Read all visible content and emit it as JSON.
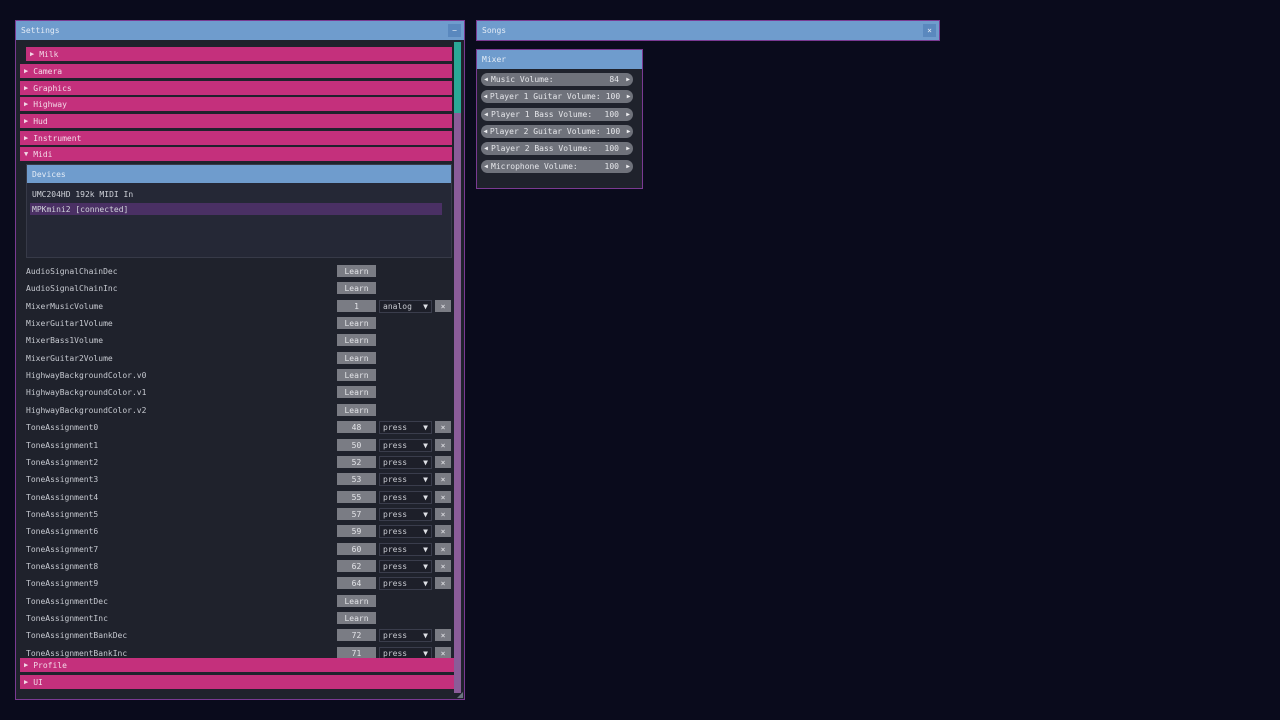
{
  "settings_window": {
    "title": "Settings",
    "collapse_glyph": "−",
    "sections_top": [
      {
        "label": "Milk",
        "arrow": "▶"
      },
      {
        "label": "Camera",
        "arrow": "▶"
      },
      {
        "label": "Graphics",
        "arrow": "▶"
      },
      {
        "label": "Highway",
        "arrow": "▶"
      },
      {
        "label": "Hud",
        "arrow": "▶"
      },
      {
        "label": "Instrument",
        "arrow": "▶"
      },
      {
        "label": "Midi",
        "arrow": "▼"
      }
    ],
    "devices": {
      "title": "Devices",
      "items": [
        "UMC204HD 192k MIDI In",
        "MPKmini2 [connected]"
      ]
    },
    "midi_rows": [
      {
        "label": "AudioSignalChainDec",
        "button": "Learn"
      },
      {
        "label": "AudioSignalChainInc",
        "button": "Learn"
      },
      {
        "label": "MixerMusicVolume",
        "button": "1",
        "mode": "analog",
        "clear": "×"
      },
      {
        "label": "MixerGuitar1Volume",
        "button": "Learn"
      },
      {
        "label": "MixerBass1Volume",
        "button": "Learn"
      },
      {
        "label": "MixerGuitar2Volume",
        "button": "Learn"
      },
      {
        "label": "HighwayBackgroundColor.v0",
        "button": "Learn"
      },
      {
        "label": "HighwayBackgroundColor.v1",
        "button": "Learn"
      },
      {
        "label": "HighwayBackgroundColor.v2",
        "button": "Learn"
      },
      {
        "label": "ToneAssignment0",
        "button": "48",
        "mode": "press",
        "clear": "×"
      },
      {
        "label": "ToneAssignment1",
        "button": "50",
        "mode": "press",
        "clear": "×"
      },
      {
        "label": "ToneAssignment2",
        "button": "52",
        "mode": "press",
        "clear": "×"
      },
      {
        "label": "ToneAssignment3",
        "button": "53",
        "mode": "press",
        "clear": "×"
      },
      {
        "label": "ToneAssignment4",
        "button": "55",
        "mode": "press",
        "clear": "×"
      },
      {
        "label": "ToneAssignment5",
        "button": "57",
        "mode": "press",
        "clear": "×"
      },
      {
        "label": "ToneAssignment6",
        "button": "59",
        "mode": "press",
        "clear": "×"
      },
      {
        "label": "ToneAssignment7",
        "button": "60",
        "mode": "press",
        "clear": "×"
      },
      {
        "label": "ToneAssignment8",
        "button": "62",
        "mode": "press",
        "clear": "×"
      },
      {
        "label": "ToneAssignment9",
        "button": "64",
        "mode": "press",
        "clear": "×"
      },
      {
        "label": "ToneAssignmentDec",
        "button": "Learn"
      },
      {
        "label": "ToneAssignmentInc",
        "button": "Learn"
      },
      {
        "label": "ToneAssignmentBankDec",
        "button": "72",
        "mode": "press",
        "clear": "×"
      },
      {
        "label": "ToneAssignmentBankInc",
        "button": "71",
        "mode": "press",
        "clear": "×"
      }
    ],
    "dropdown_glyph": "▼",
    "sections_bottom": [
      {
        "label": "Profile",
        "arrow": "▶"
      },
      {
        "label": "UI",
        "arrow": "▶"
      }
    ]
  },
  "songs_window": {
    "title": "Songs",
    "collapse_glyph": "×"
  },
  "mixer_window": {
    "title": "Mixer",
    "left_arrow": "◀",
    "right_arrow": "▶",
    "rows": [
      {
        "label": "Music Volume:",
        "value": "84"
      },
      {
        "label": "Player 1 Guitar Volume:",
        "value": "100"
      },
      {
        "label": "Player 1 Bass Volume:",
        "value": "100"
      },
      {
        "label": "Player 2 Guitar Volume:",
        "value": "100"
      },
      {
        "label": "Player 2 Bass Volume:",
        "value": "100"
      },
      {
        "label": "Microphone Volume:",
        "value": "100"
      }
    ]
  },
  "colors": {
    "background": "#0a0b1c",
    "titlebar": "#6f9ccd",
    "section_header": "#c4307c",
    "button": "#7a7c84",
    "window_border": "#7a3a92",
    "scroll_thumb": "#2aa897"
  }
}
